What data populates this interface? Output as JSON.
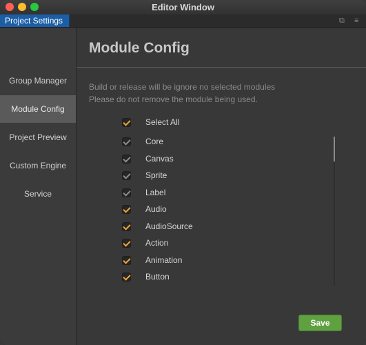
{
  "window": {
    "title": "Editor Window"
  },
  "tabbar": {
    "tab_label": "Project Settings"
  },
  "sidebar": {
    "items": [
      {
        "label": "Group Manager",
        "active": false
      },
      {
        "label": "Module Config",
        "active": true
      },
      {
        "label": "Project Preview",
        "active": false
      },
      {
        "label": "Custom Engine",
        "active": false
      },
      {
        "label": "Service",
        "active": false
      }
    ]
  },
  "main": {
    "heading": "Module Config",
    "description_line1": "Build or release will be ignore no selected modules",
    "description_line2": "Please do not remove the module being used.",
    "select_all": {
      "label": "Select All",
      "checked": true
    },
    "modules": [
      {
        "label": "Core",
        "checked": true,
        "locked": true
      },
      {
        "label": "Canvas",
        "checked": true,
        "locked": true
      },
      {
        "label": "Sprite",
        "checked": true,
        "locked": true
      },
      {
        "label": "Label",
        "checked": true,
        "locked": true
      },
      {
        "label": "Audio",
        "checked": true,
        "locked": false
      },
      {
        "label": "AudioSource",
        "checked": true,
        "locked": false
      },
      {
        "label": "Action",
        "checked": true,
        "locked": false
      },
      {
        "label": "Animation",
        "checked": true,
        "locked": false
      },
      {
        "label": "Button",
        "checked": true,
        "locked": false
      }
    ],
    "save_label": "Save"
  },
  "colors": {
    "accent_tab": "#1c5ea6",
    "check_orange": "#f3a33a",
    "save_green": "#5fa041"
  }
}
